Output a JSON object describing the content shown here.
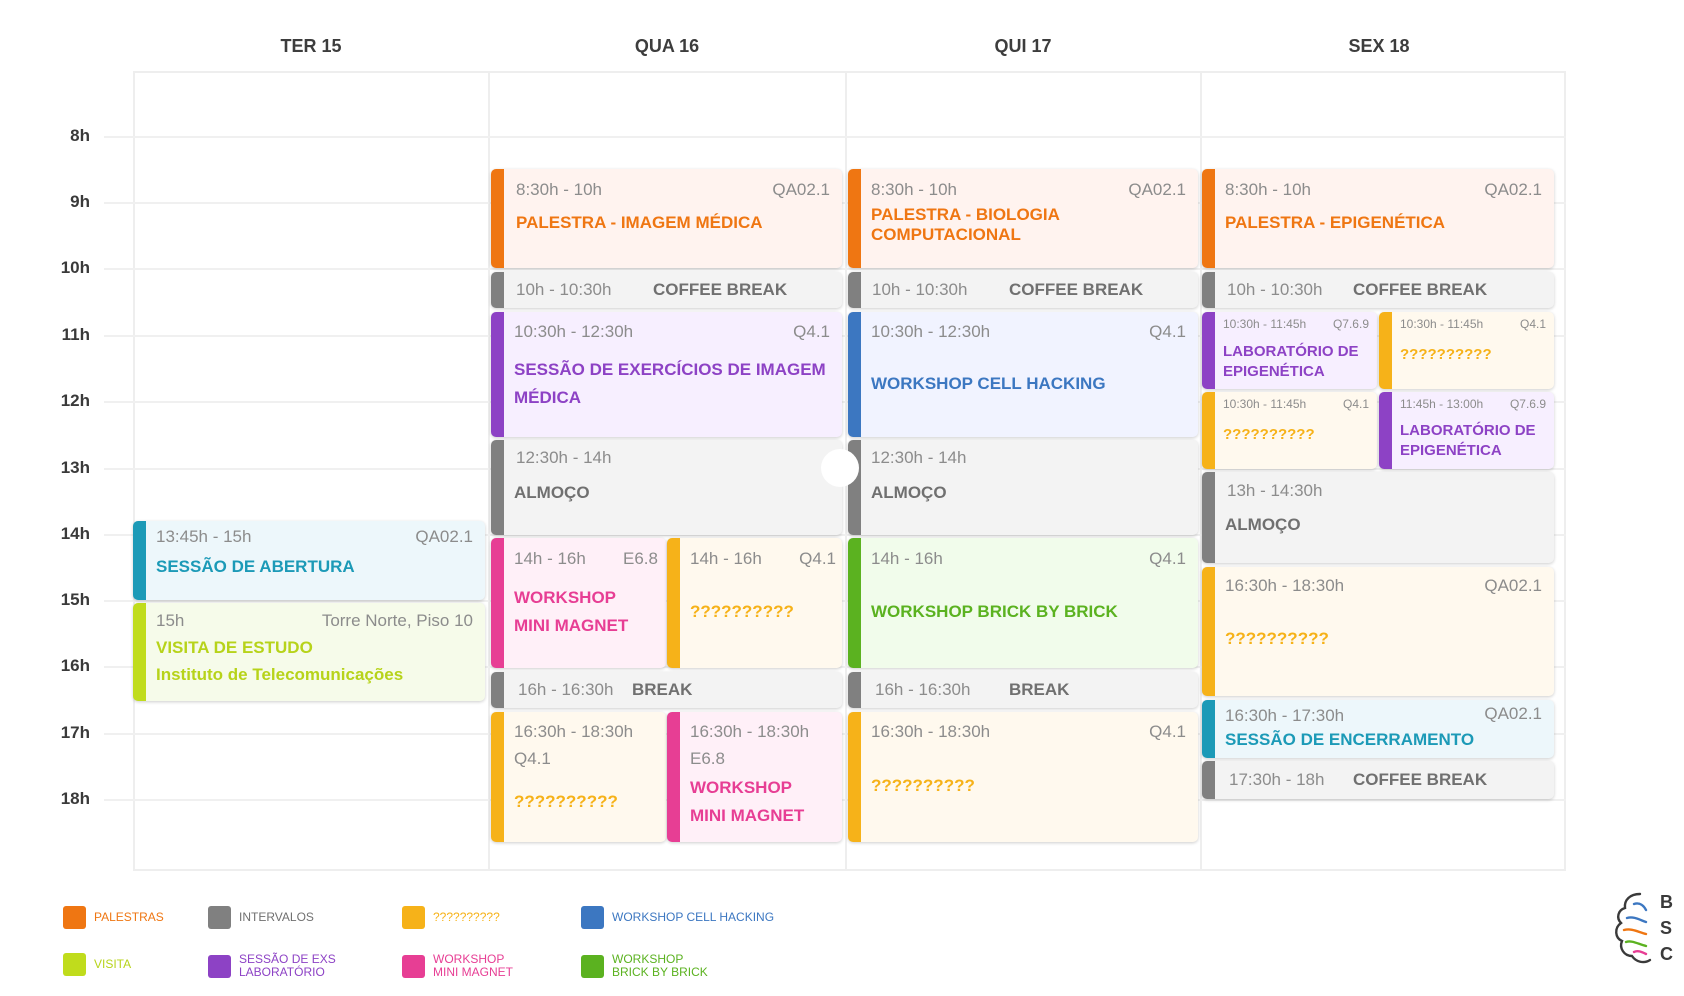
{
  "days": [
    "TER 15",
    "QUA 16",
    "QUI 17",
    "SEX 18"
  ],
  "hours": [
    "8h",
    "9h",
    "10h",
    "11h",
    "12h",
    "13h",
    "14h",
    "15h",
    "16h",
    "17h",
    "18h"
  ],
  "events": {
    "ter_abertura": {
      "time": "13:45h - 15h",
      "room": "QA02.1",
      "name": "SESSÃO DE ABERTURA"
    },
    "ter_visita": {
      "time": "15h",
      "room": "Torre Norte, Piso 10",
      "name": "VISITA DE ESTUDO",
      "subtitle": "Instituto de Telecomunicações"
    },
    "qua_palestra": {
      "time": "8:30h - 10h",
      "room": "QA02.1",
      "name": "PALESTRA - IMAGEM MÉDICA"
    },
    "qua_coffee": {
      "time": "10h - 10:30h",
      "name": "COFFEE BREAK"
    },
    "qua_sessao": {
      "time": "10:30h - 12:30h",
      "room": "Q4.1",
      "name": "SESSÃO DE EXERCÍCIOS DE IMAGEM MÉDICA"
    },
    "qua_almoco": {
      "time": "12:30h - 14h",
      "name": "ALMOÇO"
    },
    "qua_workshop_mm": {
      "time": "14h - 16h",
      "room": "E6.8",
      "name": "WORKSHOP MINI MAGNET"
    },
    "qua_unknown1": {
      "time": "14h - 16h",
      "room": "Q4.1",
      "name": "??????????"
    },
    "qua_break": {
      "time": "16h - 16:30h",
      "name": "BREAK"
    },
    "qua_unknown2": {
      "time": "16:30h - 18:30h",
      "room": "Q4.1",
      "name": "??????????"
    },
    "qua_workshop_mm2": {
      "time": "16:30h - 18:30h",
      "room": "E6.8",
      "name": "WORKSHOP MINI MAGNET"
    },
    "qui_palestra": {
      "time": "8:30h - 10h",
      "room": "QA02.1",
      "name": "PALESTRA - BIOLOGIA COMPUTACIONAL"
    },
    "qui_coffee": {
      "time": "10h - 10:30h",
      "name": "COFFEE BREAK"
    },
    "qui_cell": {
      "time": "10:30h - 12:30h",
      "room": "Q4.1",
      "name": "WORKSHOP CELL HACKING"
    },
    "qui_almoco": {
      "time": "12:30h - 14h",
      "name": "ALMOÇO"
    },
    "qui_brick": {
      "time": "14h - 16h",
      "room": "Q4.1",
      "name": "WORKSHOP BRICK BY BRICK"
    },
    "qui_break": {
      "time": "16h - 16:30h",
      "name": "BREAK"
    },
    "qui_unknown": {
      "time": "16:30h - 18:30h",
      "room": "Q4.1",
      "name": "??????????"
    },
    "sex_palestra": {
      "time": "8:30h - 10h",
      "room": "QA02.1",
      "name": "PALESTRA - EPIGENÉTICA"
    },
    "sex_coffee": {
      "time": "10h - 10:30h",
      "name": "COFFEE BREAK"
    },
    "sex_lab1": {
      "time": "10:30h - 11:45h",
      "room": "Q7.6.9",
      "name": "LABORATÓRIO DE EPIGENÉTICA"
    },
    "sex_unknown1": {
      "time": "10:30h - 11:45h",
      "room": "Q4.1",
      "name": "??????????"
    },
    "sex_unknown2": {
      "time": "10:30h - 11:45h",
      "room": "Q4.1",
      "name": "??????????"
    },
    "sex_lab2": {
      "time": "11:45h - 13:00h",
      "room": "Q7.6.9",
      "name": "LABORATÓRIO DE EPIGENÉTICA"
    },
    "sex_almoco": {
      "time": "13h - 14:30h",
      "name": "ALMOÇO"
    },
    "sex_unknown3": {
      "time": "16:30h - 18:30h",
      "room": "QA02.1",
      "name": "??????????"
    },
    "sex_encerramento": {
      "time": "16:30h - 17:30h",
      "room": "QA02.1",
      "name": "SESSÃO DE ENCERRAMENTO"
    },
    "sex_coffee2": {
      "time": "17:30h - 18h",
      "name": "COFFEE BREAK"
    }
  },
  "legend": [
    {
      "label": "PALESTRAS",
      "color": "#ef7612"
    },
    {
      "label": "INTERVALOS",
      "color": "#808080"
    },
    {
      "label": "??????????",
      "color": "#f6b219"
    },
    {
      "label": "WORKSHOP CELL HACKING",
      "color": "#3c77c1"
    },
    {
      "label": "VISITA",
      "color": "#c0dc1c"
    },
    {
      "label": "SESSÃO DE EXS\nLABORATÓRIO",
      "color": "#8d42c5"
    },
    {
      "label": "WORKSHOP\nMINI MAGNET",
      "color": "#e73e94"
    },
    {
      "label": "WORKSHOP\nBRICK BY BRICK",
      "color": "#5bb220"
    }
  ],
  "logo": {
    "letters": [
      "B",
      "S",
      "C"
    ]
  }
}
